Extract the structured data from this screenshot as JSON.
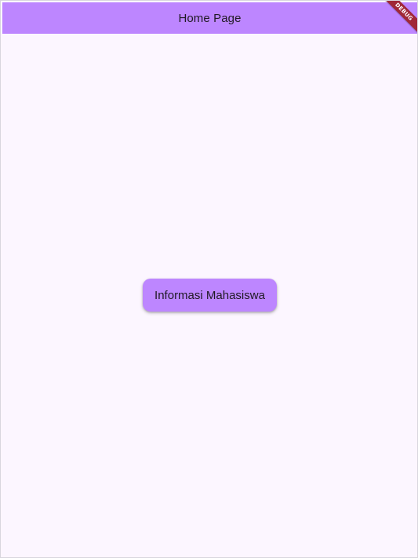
{
  "app": {
    "title": "Home Page",
    "debug_banner": "DEBUG"
  },
  "main": {
    "button_label": "Informasi Mahasiswa"
  },
  "colors": {
    "app_bar": "#bd86ff",
    "background": "#fcf6ff",
    "button": "#bd86ff",
    "debug_banner": "#a02737",
    "text": "#1f1a24"
  }
}
